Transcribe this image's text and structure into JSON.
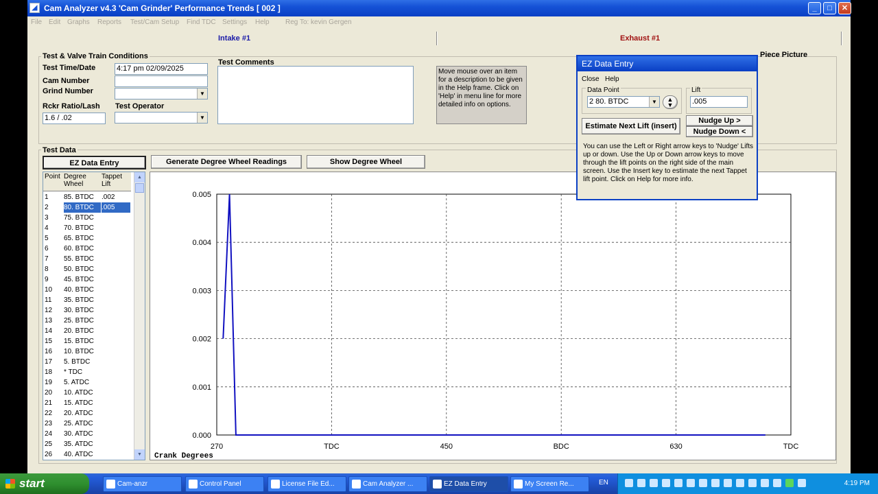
{
  "window": {
    "title": "Cam Analyzer v4.3 'Cam Grinder' Performance Trends  [ 002 ]",
    "controls": [
      "_",
      "□",
      "✕"
    ]
  },
  "menu": [
    "File",
    "Edit",
    "Graphs",
    "Reports",
    "Test/Cam Setup",
    "Find TDC",
    "Settings",
    "Help",
    "Reg To: kevin Gergen"
  ],
  "tabs": {
    "intake": "Intake #1",
    "exhaust": "Exhaust #1"
  },
  "conditions": {
    "group_label": "Test & Valve Train Conditions",
    "time_label": "Test Time/Date",
    "time_value": "4:17 pm  02/09/2025",
    "cam_label": "Cam Number",
    "cam_value": "",
    "grind_label": "Grind Number",
    "grind_value": "",
    "rocker_label": "Rckr Ratio/Lash",
    "rocker_value": "1.6  /  .02",
    "operator_label": "Test Operator",
    "operator_value": "",
    "comments_label": "Test Comments",
    "comments_value": "",
    "help_text": "Move mouse over an item for a description to be given in the Help frame.  Click on 'Help' in menu line for more detailed info on options.",
    "picture_label": "Piece Picture"
  },
  "test_data": {
    "group_label": "Test Data",
    "ez_button": "EZ Data Entry",
    "generate_button": "Generate Degree Wheel Readings",
    "show_wheel_button": "Show Degree Wheel",
    "columns": [
      "Point",
      "Degree Wheel",
      "Tappet Lift"
    ],
    "rows": [
      [
        "1",
        "85. BTDC",
        ".002"
      ],
      [
        "2",
        "80. BTDC",
        ".005"
      ],
      [
        "3",
        "75. BTDC",
        ""
      ],
      [
        "4",
        "70. BTDC",
        ""
      ],
      [
        "5",
        "65. BTDC",
        ""
      ],
      [
        "6",
        "60. BTDC",
        ""
      ],
      [
        "7",
        "55. BTDC",
        ""
      ],
      [
        "8",
        "50. BTDC",
        ""
      ],
      [
        "9",
        "45. BTDC",
        ""
      ],
      [
        "10",
        "40. BTDC",
        ""
      ],
      [
        "11",
        "35. BTDC",
        ""
      ],
      [
        "12",
        "30. BTDC",
        ""
      ],
      [
        "13",
        "25. BTDC",
        ""
      ],
      [
        "14",
        "20. BTDC",
        ""
      ],
      [
        "15",
        "15. BTDC",
        ""
      ],
      [
        "16",
        "10. BTDC",
        ""
      ],
      [
        "17",
        "5. BTDC",
        ""
      ],
      [
        "18",
        "*   TDC",
        ""
      ],
      [
        "19",
        "5. ATDC",
        ""
      ],
      [
        "20",
        "10. ATDC",
        ""
      ],
      [
        "21",
        "15. ATDC",
        ""
      ],
      [
        "22",
        "20. ATDC",
        ""
      ],
      [
        "23",
        "25. ATDC",
        ""
      ],
      [
        "24",
        "30. ATDC",
        ""
      ],
      [
        "25",
        "35. ATDC",
        ""
      ],
      [
        "26",
        "40. ATDC",
        ""
      ]
    ],
    "selected_row": 2
  },
  "chart_data": {
    "type": "line",
    "xlabel": "Crank Degrees",
    "ylabel": "",
    "xticks": [
      "270",
      "TDC",
      "450",
      "BDC",
      "630",
      "TDC"
    ],
    "yticks": [
      "0.005",
      "0.004",
      "0.003",
      "0.002",
      "0.001",
      "0.000"
    ],
    "ylim": [
      0,
      0.005
    ],
    "grid": true,
    "series": [
      {
        "color": "#1010c0",
        "points": [
          [
            275,
            0.002
          ],
          [
            280,
            0.005
          ],
          [
            285,
            0
          ],
          [
            700,
            0
          ]
        ]
      }
    ]
  },
  "ez_dialog": {
    "title": "EZ Data Entry",
    "menu": [
      "Close",
      "Help"
    ],
    "data_point_label": "Data Point",
    "data_point_value": "2     80. BTDC",
    "lift_label": "Lift",
    "lift_value": ".005",
    "estimate_button": "Estimate Next Lift (insert)",
    "nudge_up": "Nudge Up >",
    "nudge_down": "Nudge Down <",
    "note": "You can use the Left or Right arrow keys to 'Nudge' Lifts up or down.  Use the Up or Down arrow keys to move through the lift points on the right side of the main screen.  Use the Insert key to estimate the next Tappet lift point.  Click on Help for more info."
  },
  "taskbar": {
    "start": "start",
    "tasks": [
      "Cam-anzr",
      "Control Panel",
      "License File Ed...",
      "Cam Analyzer ...",
      "EZ Data Entry",
      "My Screen Re..."
    ],
    "active_task": 4,
    "language": "EN",
    "clock": "4:19 PM"
  }
}
